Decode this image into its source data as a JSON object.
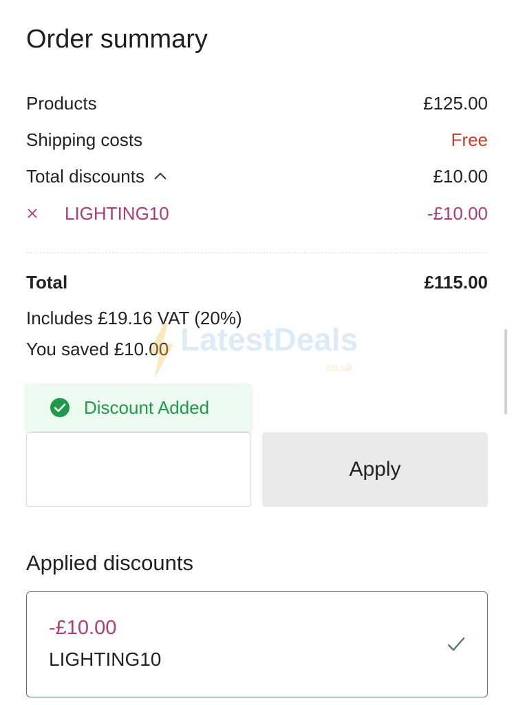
{
  "title": "Order summary",
  "summary": {
    "products_label": "Products",
    "products_value": "£125.00",
    "shipping_label": "Shipping costs",
    "shipping_value": "Free",
    "discounts_label": "Total discounts",
    "discounts_value": "£10.00",
    "discount_code": "LIGHTING10",
    "discount_code_value": "-£10.00",
    "total_label": "Total",
    "total_value": "£115.00",
    "vat_text": "Includes £19.16 VAT (20%)",
    "saved_text": "You saved £10.00"
  },
  "watermark": {
    "brand": "LatestDeals",
    "suffix": ".co.uk"
  },
  "toast": {
    "message": "Discount Added"
  },
  "promo": {
    "input_value": "",
    "input_placeholder": "",
    "apply_label": "Apply"
  },
  "applied": {
    "title": "Applied discounts",
    "items": [
      {
        "amount": "-£10.00",
        "code": "LIGHTING10"
      }
    ]
  },
  "colors": {
    "accent_discount": "#b03a7a",
    "free_text": "#c4412a",
    "success": "#1f9a4a",
    "card_border": "#557a6c"
  },
  "icons": {
    "remove": "close-icon",
    "collapse": "chevron-up-icon",
    "toast": "check-circle-icon",
    "selected": "checkmark-icon"
  }
}
